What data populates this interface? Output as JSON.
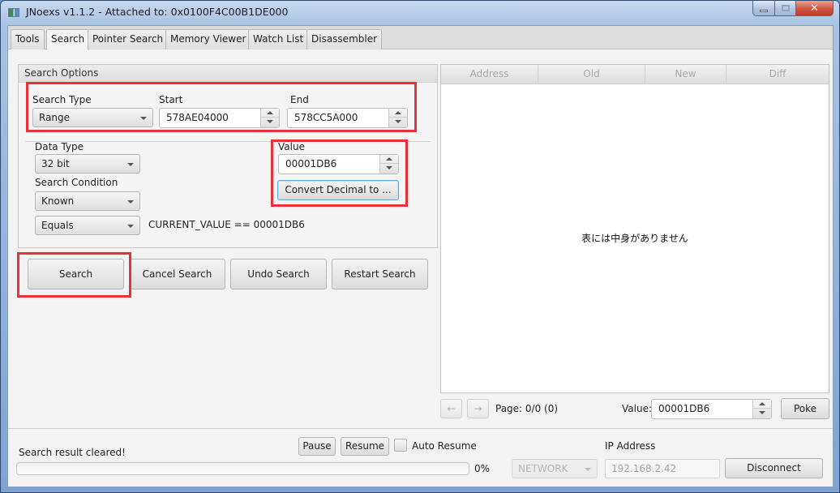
{
  "window": {
    "title": "JNoexs v1.1.2 - Attached to: 0x0100F4C00B1DE000",
    "controls": {
      "minimize_icon": "minimize-icon",
      "maximize_icon": "maximize-icon",
      "close_glyph": "✕"
    }
  },
  "tabs": [
    {
      "label": "Tools",
      "active": false
    },
    {
      "label": "Search",
      "active": true
    },
    {
      "label": "Pointer Search",
      "active": false
    },
    {
      "label": "Memory Viewer",
      "active": false
    },
    {
      "label": "Watch List",
      "active": false
    },
    {
      "label": "Disassembler",
      "active": false
    }
  ],
  "search_options": {
    "header": "Search Options",
    "search_type": {
      "label": "Search Type",
      "value": "Range"
    },
    "start": {
      "label": "Start",
      "value": "578AE04000"
    },
    "end": {
      "label": "End",
      "value": "578CC5A000"
    },
    "data_type": {
      "label": "Data Type",
      "value": "32 bit"
    },
    "search_condition": {
      "label": "Search Condition",
      "value": "Known"
    },
    "comparison": {
      "value": "Equals"
    },
    "expression": "CURRENT_VALUE == 00001DB6",
    "value": {
      "label": "Value",
      "value": "00001DB6"
    },
    "convert_button": "Convert Decimal to ..."
  },
  "actions": {
    "search": "Search",
    "cancel_search": "Cancel Search",
    "undo_search": "Undo Search",
    "restart_search": "Restart Search"
  },
  "results_table": {
    "columns": [
      "Address",
      "Old",
      "New",
      "Diff"
    ],
    "rows": [],
    "empty_message": "表には中身がありません"
  },
  "pagination": {
    "prev_glyph": "←",
    "next_glyph": "→",
    "page_text": "Page: 0/0 (0)",
    "value_label": "Value:",
    "value": "00001DB6",
    "poke_button": "Poke"
  },
  "status": {
    "message": "Search result cleared!",
    "pause_button": "Pause",
    "resume_button": "Resume",
    "auto_resume_label": "Auto Resume",
    "auto_resume_checked": false,
    "progress_percent": 0,
    "progress_text": "0%"
  },
  "connection": {
    "mode": "NETWORK",
    "ip_label": "IP Address",
    "ip_value": "192.168.2.42",
    "disconnect_button": "Disconnect"
  },
  "colors": {
    "highlight_red": "#e8323a",
    "focus_blue": "#5ea6d8",
    "close_red": "#c0382a"
  }
}
